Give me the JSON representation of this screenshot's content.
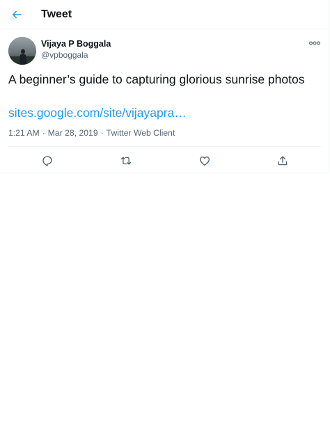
{
  "header": {
    "title": "Tweet",
    "back_icon": "back-arrow-icon",
    "accent_color": "#1d9bf0"
  },
  "tweet": {
    "author": {
      "name": "Vijaya P Boggala",
      "handle": "@vpboggala"
    },
    "more_icon": "more-options-icon",
    "text": "A beginner’s guide to capturing glorious sunrise photos",
    "link": "sites.google.com/site/vijayapra…",
    "meta": {
      "time": "1:21 AM",
      "separator": "·",
      "date": "Mar 28, 2019",
      "client": "Twitter Web Client"
    },
    "actions": [
      {
        "name": "reply",
        "icon": "reply-icon"
      },
      {
        "name": "retweet",
        "icon": "retweet-icon"
      },
      {
        "name": "like",
        "icon": "heart-icon"
      },
      {
        "name": "share",
        "icon": "share-icon"
      }
    ]
  },
  "colors": {
    "text_primary": "#0f1419",
    "text_secondary": "#536471",
    "link": "#1d9bf0",
    "border": "#eff3f4"
  }
}
